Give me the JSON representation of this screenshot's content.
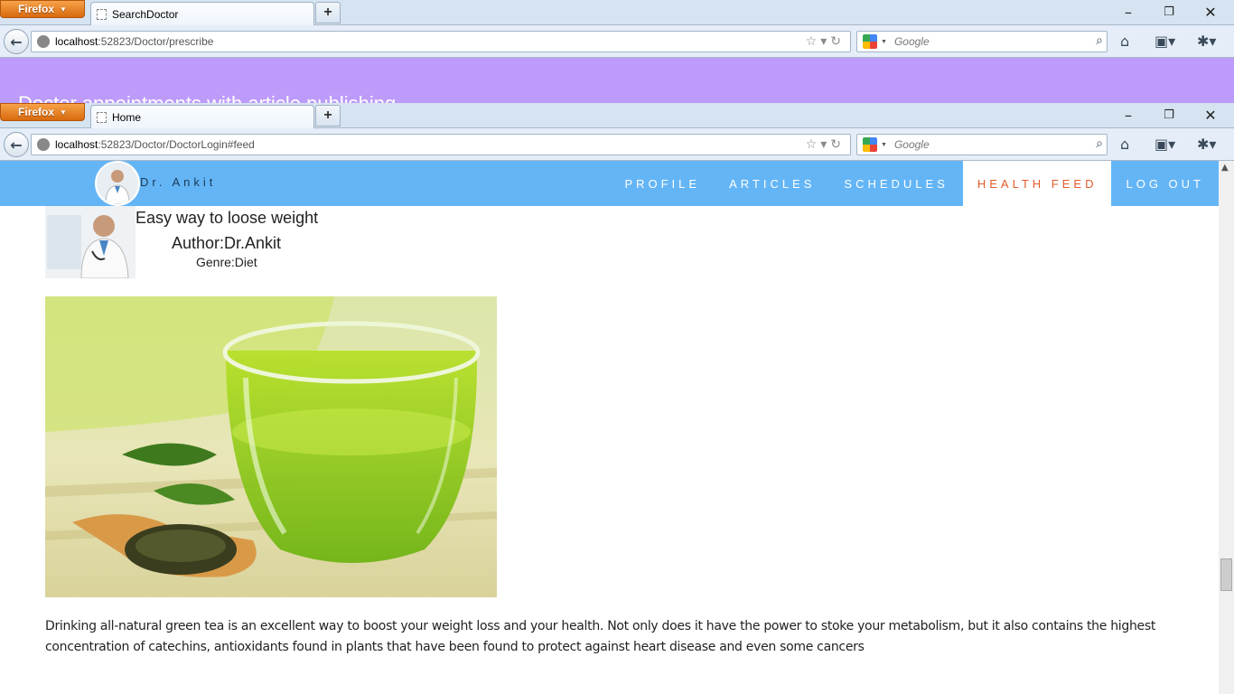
{
  "window1": {
    "menu_button": "Firefox",
    "tab_title": "SearchDoctor",
    "url_host": "localhost",
    "url_rest": ":52823/Doctor/prescribe",
    "search_placeholder": "Google",
    "page_banner_text": "Doctor appointments with article publishing"
  },
  "window2": {
    "menu_button": "Firefox",
    "tab_title": "Home",
    "url_host": "localhost",
    "url_rest": ":52823/Doctor/DoctorLogin#feed",
    "search_placeholder": "Google"
  },
  "site": {
    "brand": "Dr. Ankit",
    "nav": [
      "PROFILE",
      "ARTICLES",
      "SCHEDULES",
      "HEALTH FEED",
      "LOG OUT"
    ],
    "active_nav": "HEALTH FEED"
  },
  "article": {
    "title": "Easy way to loose weight",
    "author": "Author:Dr.Ankit",
    "genre": "Genre:Diet",
    "body": "Drinking all-natural green tea is an excellent way to boost your weight loss and your health. Not only does it have the power to stoke your metabolism, but it also contains the highest concentration of catechins, antioxidants found in plants that have been found to protect against heart disease and even some cancers"
  },
  "colors": {
    "purple_banner": "#bd9bfb",
    "site_header": "#64b5f6",
    "active_nav_text": "#e35b2c"
  }
}
